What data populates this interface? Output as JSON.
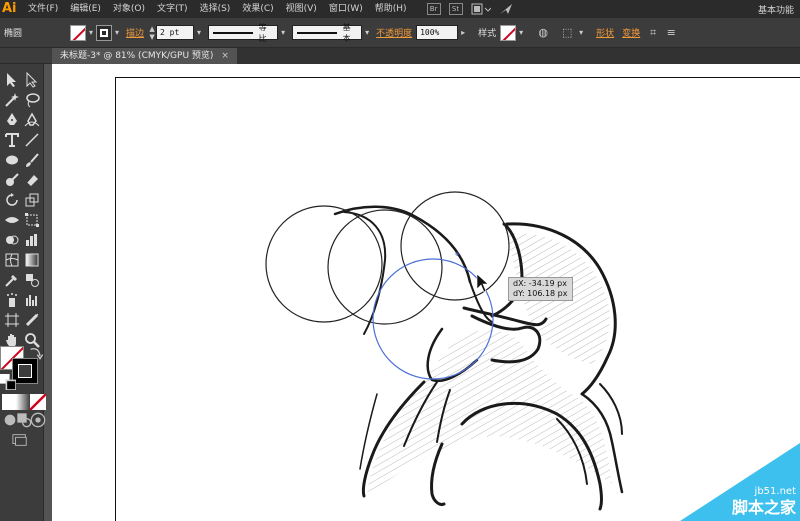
{
  "app": {
    "logo": "Ai",
    "workspace": "基本功能"
  },
  "menu": [
    {
      "label": "文件(F)",
      "name": "menu-file"
    },
    {
      "label": "编辑(E)",
      "name": "menu-edit"
    },
    {
      "label": "对象(O)",
      "name": "menu-object"
    },
    {
      "label": "文字(T)",
      "name": "menu-type"
    },
    {
      "label": "选择(S)",
      "name": "menu-select"
    },
    {
      "label": "效果(C)",
      "name": "menu-effect"
    },
    {
      "label": "视图(V)",
      "name": "menu-view"
    },
    {
      "label": "窗口(W)",
      "name": "menu-window"
    },
    {
      "label": "帮助(H)",
      "name": "menu-help"
    }
  ],
  "menu_icons": {
    "bridge": "Br",
    "stock": "St"
  },
  "control": {
    "selection_label": "椭圆",
    "stroke_label": "描边",
    "stroke_weight": "2 pt",
    "profile_label": "等比",
    "brush_label": "基本",
    "opacity_label": "不透明度",
    "opacity_value": "100%",
    "style_label": "样式",
    "shape_label": "形状",
    "transform_label": "变换"
  },
  "document_tab": {
    "title": "未标题-3* @ 81% (CMYK/GPU 预览)",
    "close": "×"
  },
  "tooltip": {
    "dx": "dX: -34.19 px",
    "dy": "dY: 106.18 px"
  },
  "watermark": {
    "site": "jb51.net",
    "name": "脚本之家"
  },
  "colors": {
    "accent": "#ff9a00",
    "label_orange": "#f29a3a",
    "selection_blue": "#4a6fd6",
    "watermark_blue": "#3ec0ee"
  }
}
